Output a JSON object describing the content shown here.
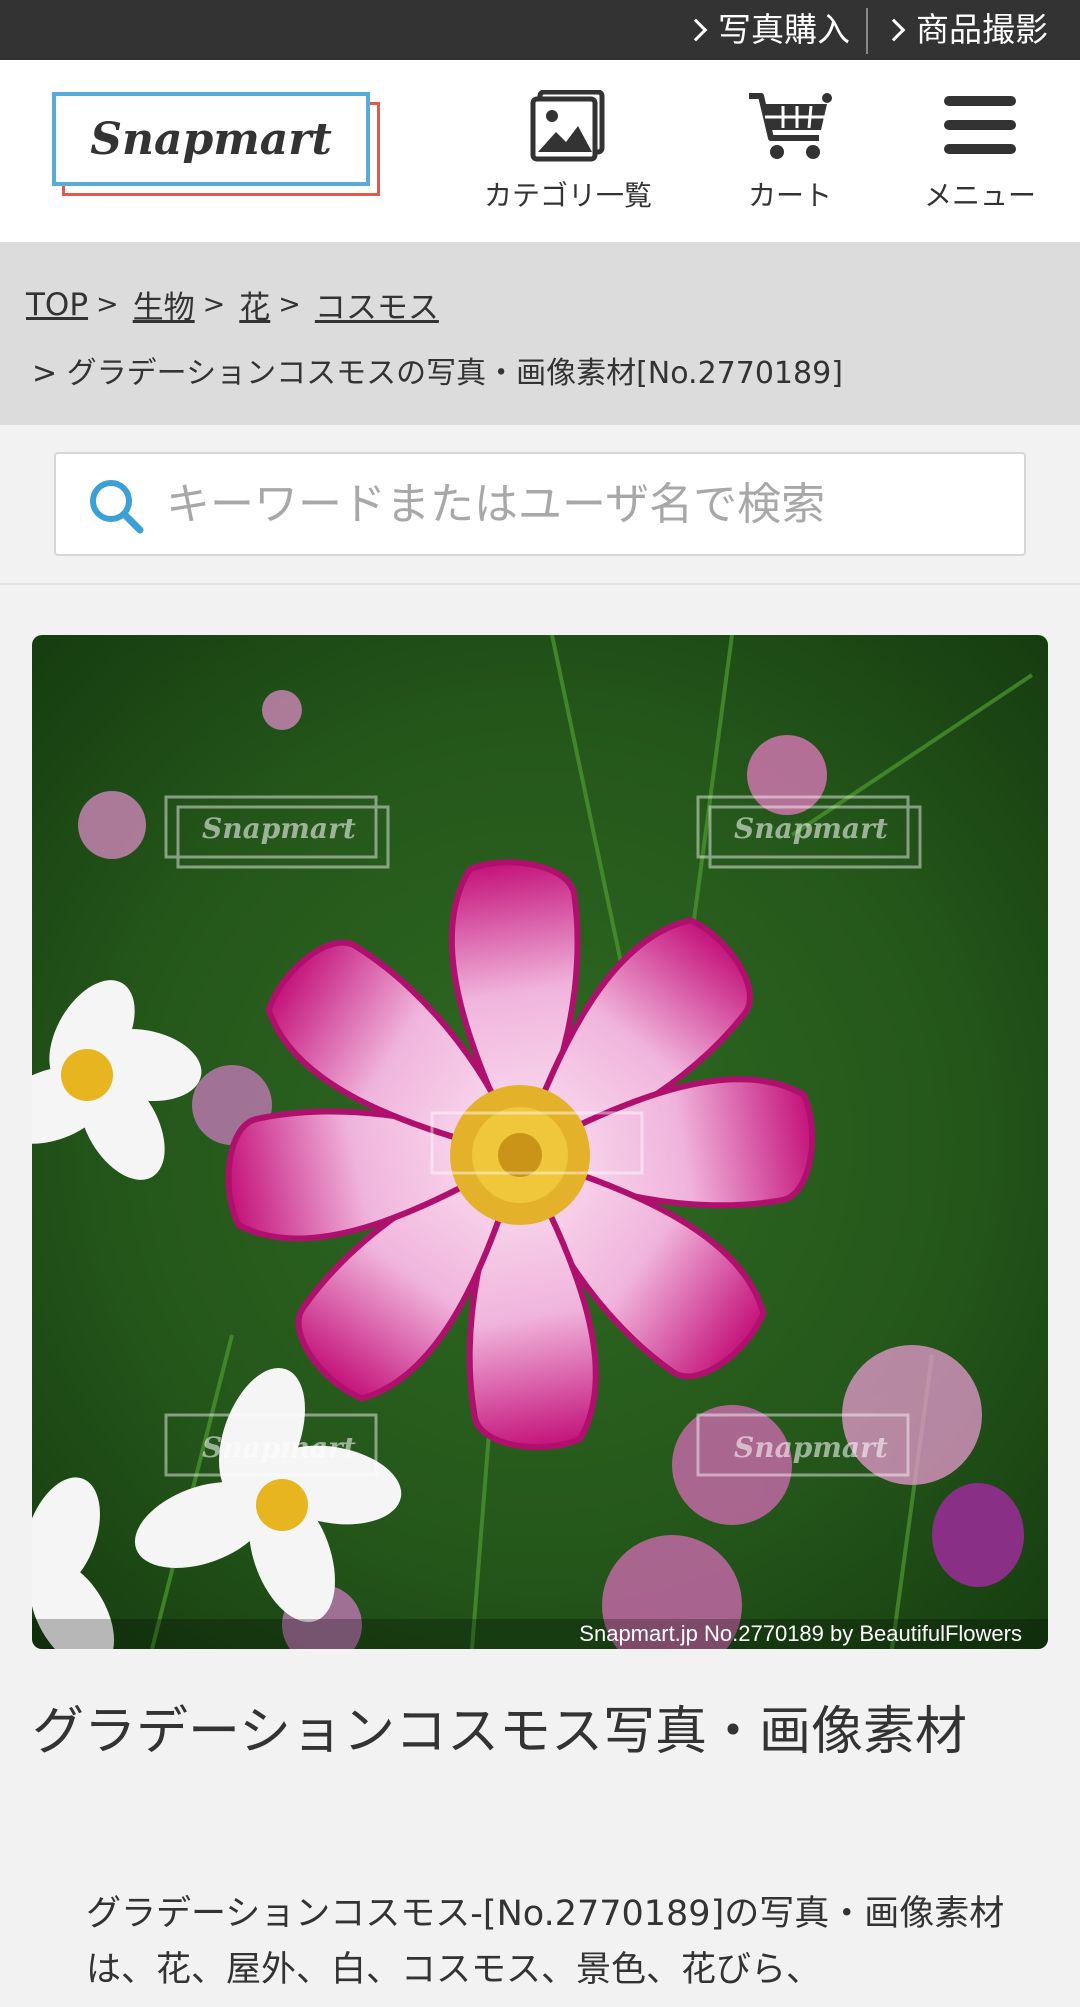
{
  "topbar": {
    "links": [
      "写真購入",
      "商品撮影"
    ]
  },
  "header": {
    "logo_text": "Snapmart",
    "nav": [
      {
        "label": "カテゴリ一覧",
        "icon": "image-icon"
      },
      {
        "label": "カート",
        "icon": "cart-icon"
      },
      {
        "label": "メニュー",
        "icon": "hamburger-menu-icon"
      }
    ]
  },
  "breadcrumb": {
    "items": [
      "TOP",
      "生物",
      "花",
      "コスモス"
    ],
    "separator": ">",
    "current": "> グラデーションコスモスの写真・画像素材[No.2770189]"
  },
  "search": {
    "placeholder": "キーワードまたはユーザ名で検索",
    "value": ""
  },
  "photo": {
    "watermark": "Snapmart",
    "credit": "Snapmart.jp No.2770189 by BeautifulFlowers"
  },
  "content": {
    "title": "グラデーションコスモス写真・画像素材",
    "description": "グラデーションコスモス-[No.2770189]の写真・画像素材は、花、屋外、白、コスモス、景色、花びら、"
  },
  "colors": {
    "topbar_bg": "#333333",
    "logo_blue": "#58abd6",
    "logo_red": "#e4574d",
    "search_icon": "#3aa0d6",
    "breadcrumb_bg": "#dcdcdc"
  }
}
